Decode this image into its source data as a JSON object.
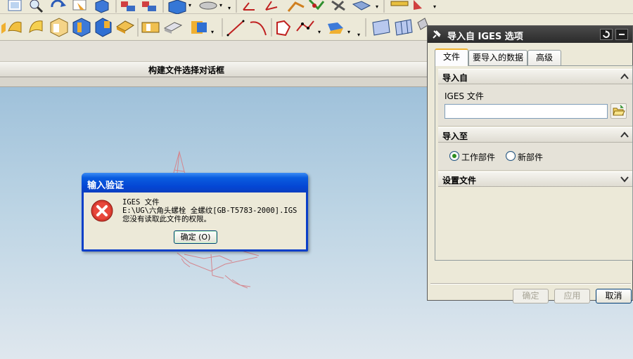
{
  "toolbar": {
    "row1_icons": [
      "fit-icon",
      "zoom-icon",
      "rotate-icon",
      "pan-icon",
      "orient-view-icon",
      "layer-icon",
      "layer-settings-icon",
      "shaded-view-icon",
      "render-style-icon",
      "datum-csys-icon",
      "wcs-origin-icon",
      "wcs-rotate-icon",
      "analysis-icon",
      "snap-icon",
      "measure-icon",
      "display-edit-icon"
    ],
    "row2_icons": [
      "extrude-icon",
      "revolve-icon",
      "sweep-icon",
      "block-icon",
      "cylinder-icon",
      "cone-icon",
      "sphere-icon",
      "boolean-icon",
      "trim-icon",
      "feature-icon",
      "line-icon",
      "arc-icon",
      "sketch-icon",
      "spline-icon",
      "point-icon",
      "face-icon",
      "mesh-surface-icon",
      "through-curves-icon",
      "surface-trim-icon",
      "surface-extend-icon",
      "offset-surface-icon"
    ]
  },
  "header": {
    "file_dialog_title": "构建文件选择对话框"
  },
  "error_dialog": {
    "title": "输入验证",
    "line1": "IGES 文件",
    "line2": "E:\\UG\\六角头螺栓 全螺纹[GB-T5783-2000].IGS",
    "line3": "您没有读取此文件的权限。",
    "ok_label": "确定 (O)"
  },
  "iges_dialog": {
    "title": "导入自 IGES 选项",
    "tabs": [
      "文件",
      "要导入的数据",
      "高级"
    ],
    "active_tab": 0,
    "section_import_from": "导入自",
    "file_label": "IGES 文件",
    "file_value": "",
    "section_import_to": "导入至",
    "radio_work_part": "工作部件",
    "radio_new_part": "新部件",
    "selected_radio": "工作部件",
    "section_settings_file": "设置文件",
    "btn_ok": "确定",
    "btn_apply": "应用",
    "btn_cancel": "取消",
    "accent_color": "#f0b22f"
  }
}
